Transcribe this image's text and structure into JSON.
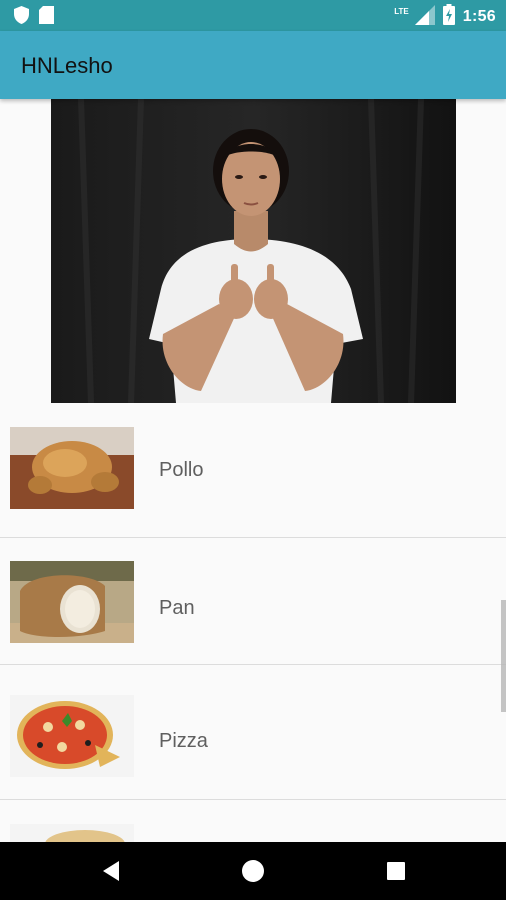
{
  "status_bar": {
    "time": "1:56",
    "network_label": "LTE",
    "icons": [
      "shield-icon",
      "sim-card-icon",
      "signal-icon",
      "battery-icon"
    ]
  },
  "app_bar": {
    "title": "HNLesho"
  },
  "video": {
    "description_icon": "sign-language-video"
  },
  "list": {
    "items": [
      {
        "label": "Pollo",
        "image_icon": "roast-chicken-image"
      },
      {
        "label": "Pan",
        "image_icon": "bread-image"
      },
      {
        "label": "Pizza",
        "image_icon": "pizza-image"
      },
      {
        "label": "",
        "image_icon": "food-image"
      }
    ]
  },
  "nav_bar": {
    "icons": [
      "back-icon",
      "home-icon",
      "recents-icon"
    ]
  },
  "colors": {
    "status_bar": "#2e9aa4",
    "app_bar": "#3fa9c4",
    "background": "#fafafa",
    "nav_bar": "#000000"
  }
}
